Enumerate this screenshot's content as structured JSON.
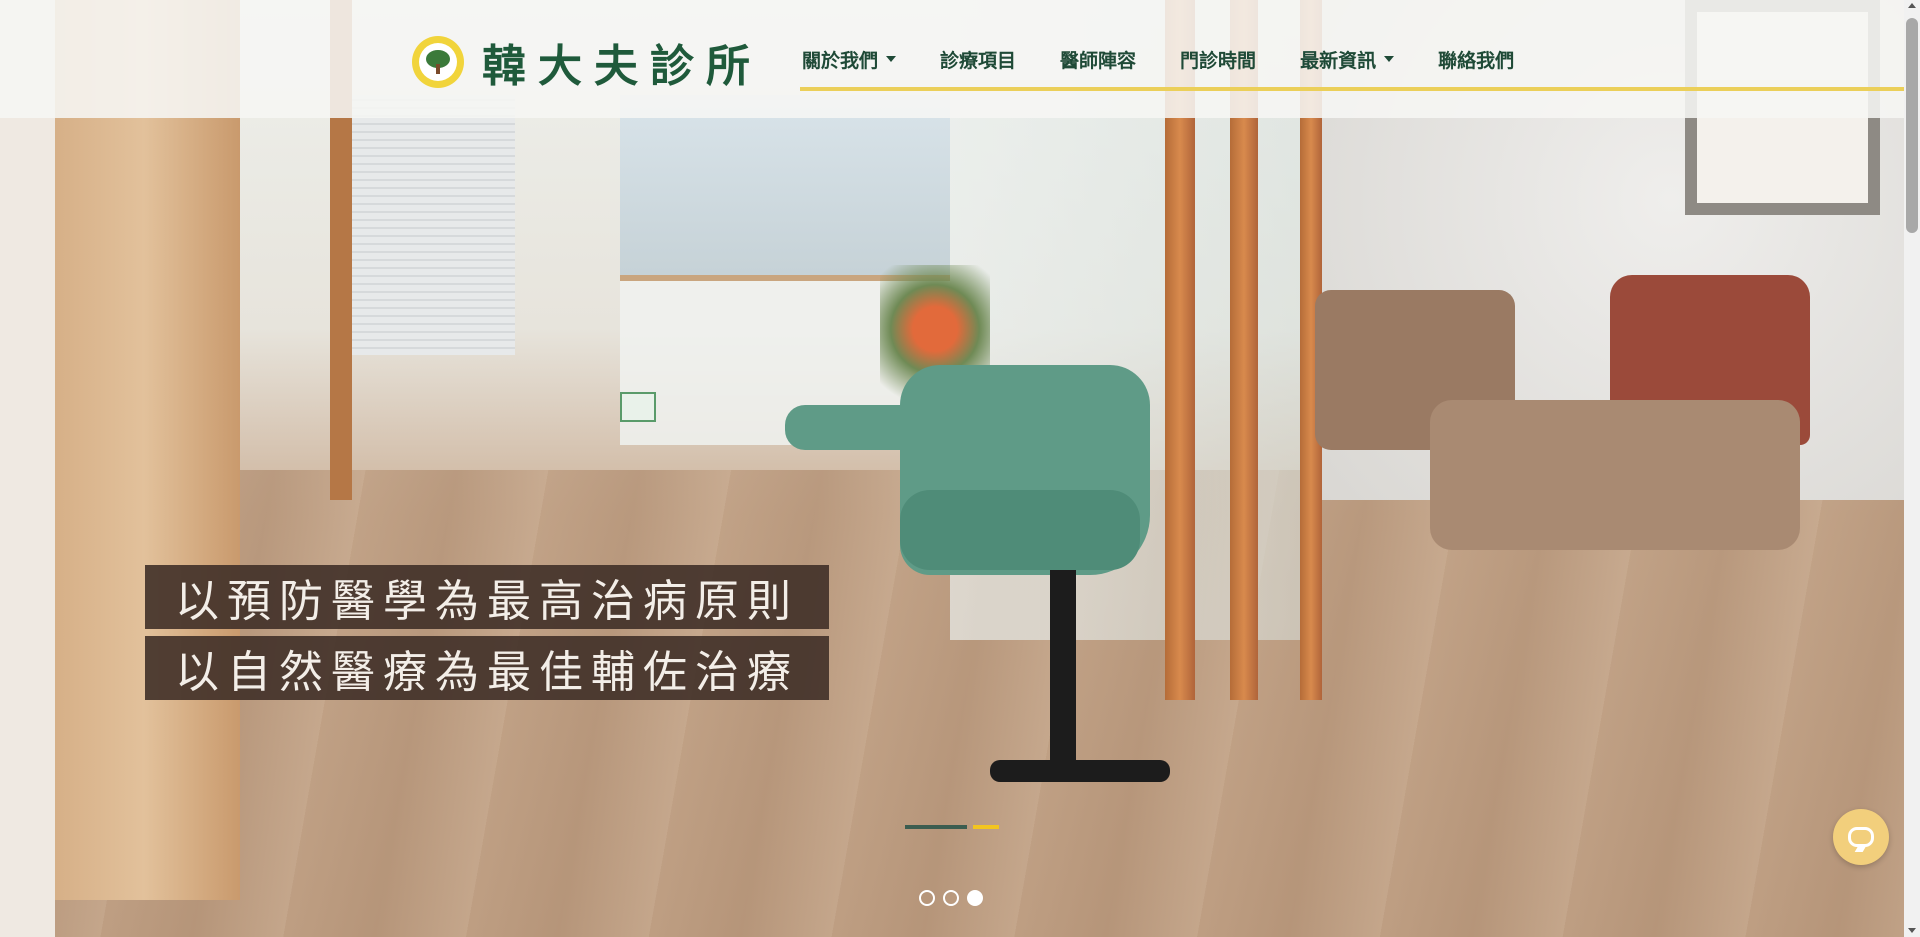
{
  "brand": {
    "name": "韓大夫診所",
    "logo_icon": "tree-icon",
    "primary_color": "#1f5a3b",
    "accent_color": "#ebcf59"
  },
  "nav": {
    "items": [
      {
        "label": "關於我們",
        "has_dropdown": true
      },
      {
        "label": "診療項目",
        "has_dropdown": false
      },
      {
        "label": "醫師陣容",
        "has_dropdown": false
      },
      {
        "label": "門診時間",
        "has_dropdown": false
      },
      {
        "label": "最新資訊",
        "has_dropdown": true
      },
      {
        "label": "聯絡我們",
        "has_dropdown": false
      }
    ]
  },
  "hero": {
    "slogans": [
      "以預防醫學為最高治病原則",
      "以自然醫療為最佳輔佐治療"
    ],
    "slide_count": 3,
    "active_slide": 3,
    "progress_active_color": "#3c5d50",
    "progress_accent_color": "#f3c520"
  },
  "chat": {
    "icon": "chat-bubble-icon",
    "color": "#f2cf7c"
  }
}
